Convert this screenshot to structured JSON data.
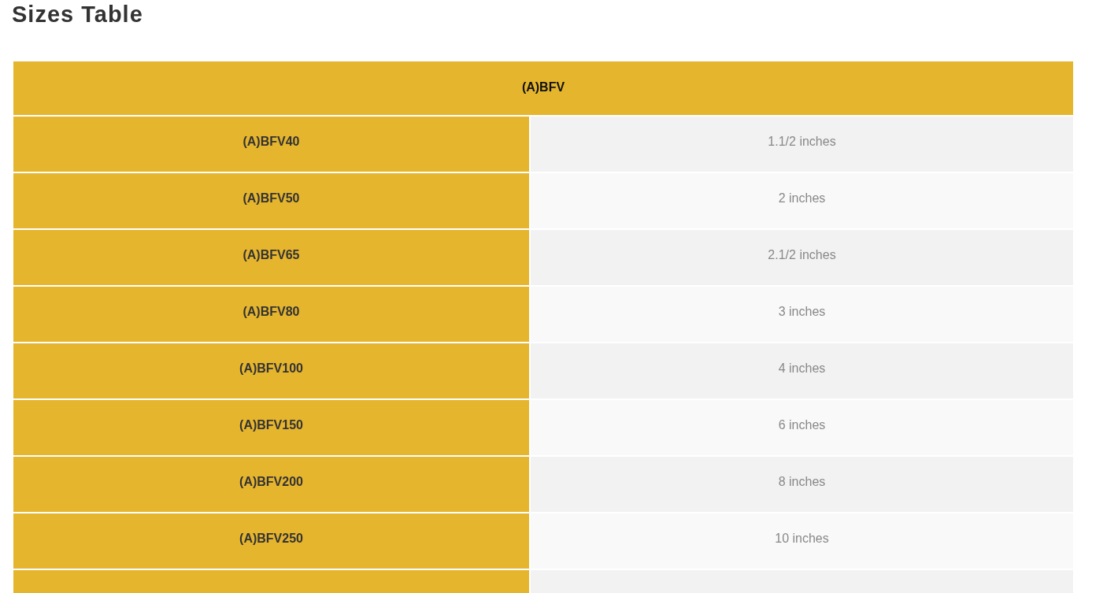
{
  "title": "Sizes Table",
  "table": {
    "header": "(A)BFV",
    "rows": [
      {
        "model": "(A)BFV40",
        "size": "1.1/2 inches"
      },
      {
        "model": "(A)BFV50",
        "size": "2 inches"
      },
      {
        "model": "(A)BFV65",
        "size": "2.1/2 inches"
      },
      {
        "model": "(A)BFV80",
        "size": "3 inches"
      },
      {
        "model": "(A)BFV100",
        "size": "4 inches"
      },
      {
        "model": "(A)BFV150",
        "size": "6 inches"
      },
      {
        "model": "(A)BFV200",
        "size": "8 inches"
      },
      {
        "model": "(A)BFV250",
        "size": "10 inches"
      }
    ]
  }
}
